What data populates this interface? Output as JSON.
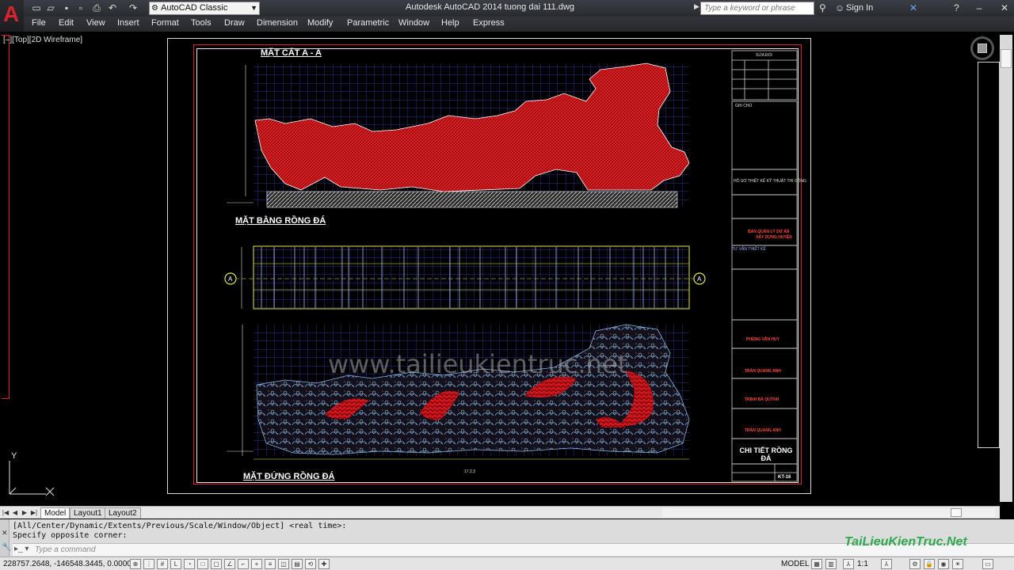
{
  "app": {
    "window_title": "Autodesk AutoCAD 2014   tuong dai 111.dwg",
    "logo_letter": "A",
    "workspace": "AutoCAD Classic",
    "search_placeholder": "Type a keyword or phrase",
    "sign_in": "Sign In"
  },
  "menu": [
    "File",
    "Edit",
    "View",
    "Insert",
    "Format",
    "Tools",
    "Draw",
    "Dimension",
    "Modify",
    "Parametric",
    "Window",
    "Help",
    "Express"
  ],
  "viewport": {
    "label": "[–][Top][2D Wireframe]",
    "ucs_y": "Y"
  },
  "drawing": {
    "section_aa": "MẶT CẮT A - A",
    "plan": "MẶT BẰNG RỒNG ĐÁ",
    "elevation": "MẶT ĐỨNG RỒNG ĐÁ",
    "watermark": "www.tailieukientruc.net",
    "section_marker": "A",
    "overall_dim": "17.2.3"
  },
  "title_block": {
    "revision_header": "SỬA ĐỔI",
    "notes": "GHI CHÚ",
    "design_stage": "HỒ SƠ THIẾT KẾ KỸ THUẬT THI CÔNG",
    "client_line1": "BAN QUẢN LÝ DỰ ÁN",
    "client_line2": "XÂY DỰNG HUYỆN",
    "consultant": "TƯ VẤN THIẾT KẾ",
    "name_1": "PHÙNG VĂN HUY",
    "name_2": "TRẦN QUANG ANH",
    "name_3": "TRỊNH BÁ QUỲNH",
    "name_4": "TRẦN QUANG ANH",
    "drawing_title": "CHI TIẾT RỒNG ĐÁ",
    "sheet_no": "KT-16"
  },
  "tabs": [
    "Model",
    "Layout1",
    "Layout2"
  ],
  "command": {
    "line1": "[All/Center/Dynamic/Extents/Previous/Scale/Window/Object] <real time>:",
    "line2": "Specify opposite corner:",
    "placeholder": "Type a command"
  },
  "status": {
    "coordinates": "228757.2648, -146548.3445, 0.0000",
    "space": "MODEL",
    "annotation_scale": "1:1"
  },
  "brand_watermark": "TaiLieuKienTruc.Net",
  "colors": {
    "drawing_bg": "#000000",
    "hatch_red": "#c8141a",
    "grid_blue": "#3b3b9e",
    "titlebar": "#2f3136",
    "brand_green": "#2fa84f"
  }
}
